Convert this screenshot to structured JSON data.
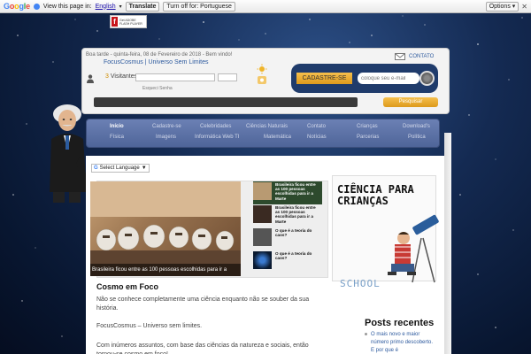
{
  "translate_bar": {
    "logo": "Google",
    "view_text": "View this page in:",
    "language": "English",
    "translate_label": "Translate",
    "turn_off_label": "Turn off for: Portuguese",
    "options_label": "Options ▾",
    "close_label": "✕"
  },
  "flash_badge": {
    "icon": "f",
    "text": "Get ADOBE FLASH PLAYER"
  },
  "header": {
    "greeting": "Boa tarde - quinta-feira, 08 de Fevereiro de 2018 - Bem vindo!",
    "site_title": "FocusCosmus | Universo Sem Limites",
    "visitors_count": "3",
    "visitors_label": "Visitantes",
    "forgot_password": "Esqueci Senha",
    "contato": "CONTATO",
    "signup_label": "CADASTRE-SE",
    "email_placeholder": "coloque seu e-mail",
    "search_label": "Pesquisar"
  },
  "nav": {
    "items": [
      {
        "label": "Início"
      },
      {
        "label": "Cadastre-se"
      },
      {
        "label": "Celebridades"
      },
      {
        "label": "Ciências Naturais"
      },
      {
        "label": "Contato"
      },
      {
        "label": "Crianças"
      },
      {
        "label": "Download's"
      },
      {
        "label": "Física"
      },
      {
        "label": "Imagens"
      },
      {
        "label": "Informática Web TI"
      },
      {
        "label": "Matemática"
      },
      {
        "label": "Notícias"
      },
      {
        "label": "Parcerias"
      },
      {
        "label": "Política"
      }
    ]
  },
  "content": {
    "select_language": "Select Language",
    "slider_caption": "Brasileira ficou entre as 100 pessoas escolhidas para ir a",
    "thumbs": [
      {
        "text": "Brasileira ficou entre as 100 pessoas escolhidas para ir a Marte"
      },
      {
        "text": "Brasileira ficou entre as 100 pessoas escolhidas para ir a Marte"
      },
      {
        "text": "O que é a teoria do caos?"
      },
      {
        "text": "O que é a teoria do caos?"
      }
    ],
    "children_title_1": "CIÊNCIA PARA",
    "children_title_2": "CRIANÇAS",
    "school_text": "SCHOOL",
    "section_heading": "Cosmo em Foco",
    "para1": "Não se conhece completamente uma ciência enquanto não se souber da sua história.",
    "para2": "FocusCosmus – Universo sem limites.",
    "para3": "Com inúmeros assuntos, com base das ciências da natureza e sociais, então tornou-se cosmo em foco!",
    "posts_heading": "Posts recentes",
    "post_1": "O mais novo e maior número primo descoberto. E por que é"
  }
}
